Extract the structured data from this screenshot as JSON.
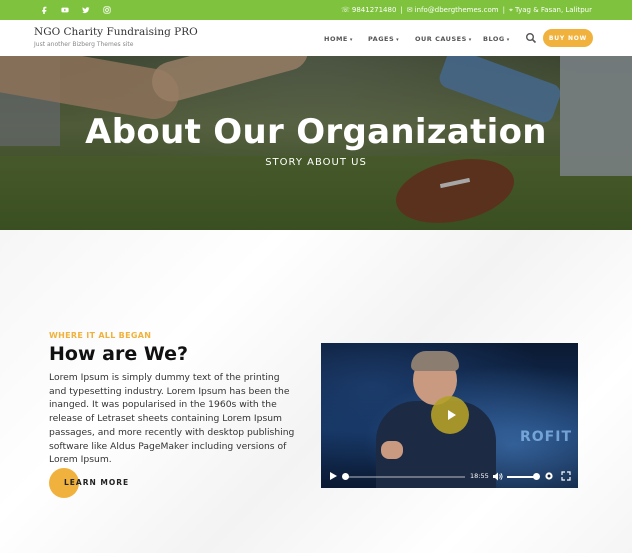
{
  "topbar": {
    "bg_color": "#7ec23d",
    "social": [
      {
        "icon": "facebook-icon",
        "glyph": "f"
      },
      {
        "icon": "youtube-icon",
        "glyph": "▶"
      },
      {
        "icon": "twitter-icon",
        "glyph": "t"
      },
      {
        "icon": "instagram-icon",
        "glyph": "◎"
      }
    ],
    "phone": "9841271480",
    "email": "info@dbergthemes.com",
    "address": "Tyag & Fasan, Lalitpur"
  },
  "header": {
    "site_title": "NGO Charity Fundraising PRO",
    "site_tagline": "Just another Bizberg Themes site",
    "nav": [
      {
        "label": "HOME"
      },
      {
        "label": "PAGES"
      },
      {
        "label": "OUR CAUSES"
      },
      {
        "label": "BLOG"
      }
    ],
    "buy_label": "BUY NOW",
    "accent_color": "#f0b23c"
  },
  "hero": {
    "title": "About Our Organization",
    "subtitle": "STORY ABOUT US"
  },
  "about": {
    "eyebrow": "WHERE IT ALL BEGAN",
    "title": "How are We?",
    "body": "Lorem Ipsum is simply dummy text of the printing and typesetting industry. Lorem Ipsum has been the inanged. It was popularised in the 1960s with the release of Letraset sheets containing Lorem Ipsum passages, and more recently with desktop publishing software like Aldus PageMaker including versions of Lorem Ipsum.",
    "button_label": "LEARN MORE"
  },
  "video": {
    "time": "18:55",
    "progress": 0.0,
    "volume": 0.85,
    "backdrop_text": "ROFIT"
  }
}
